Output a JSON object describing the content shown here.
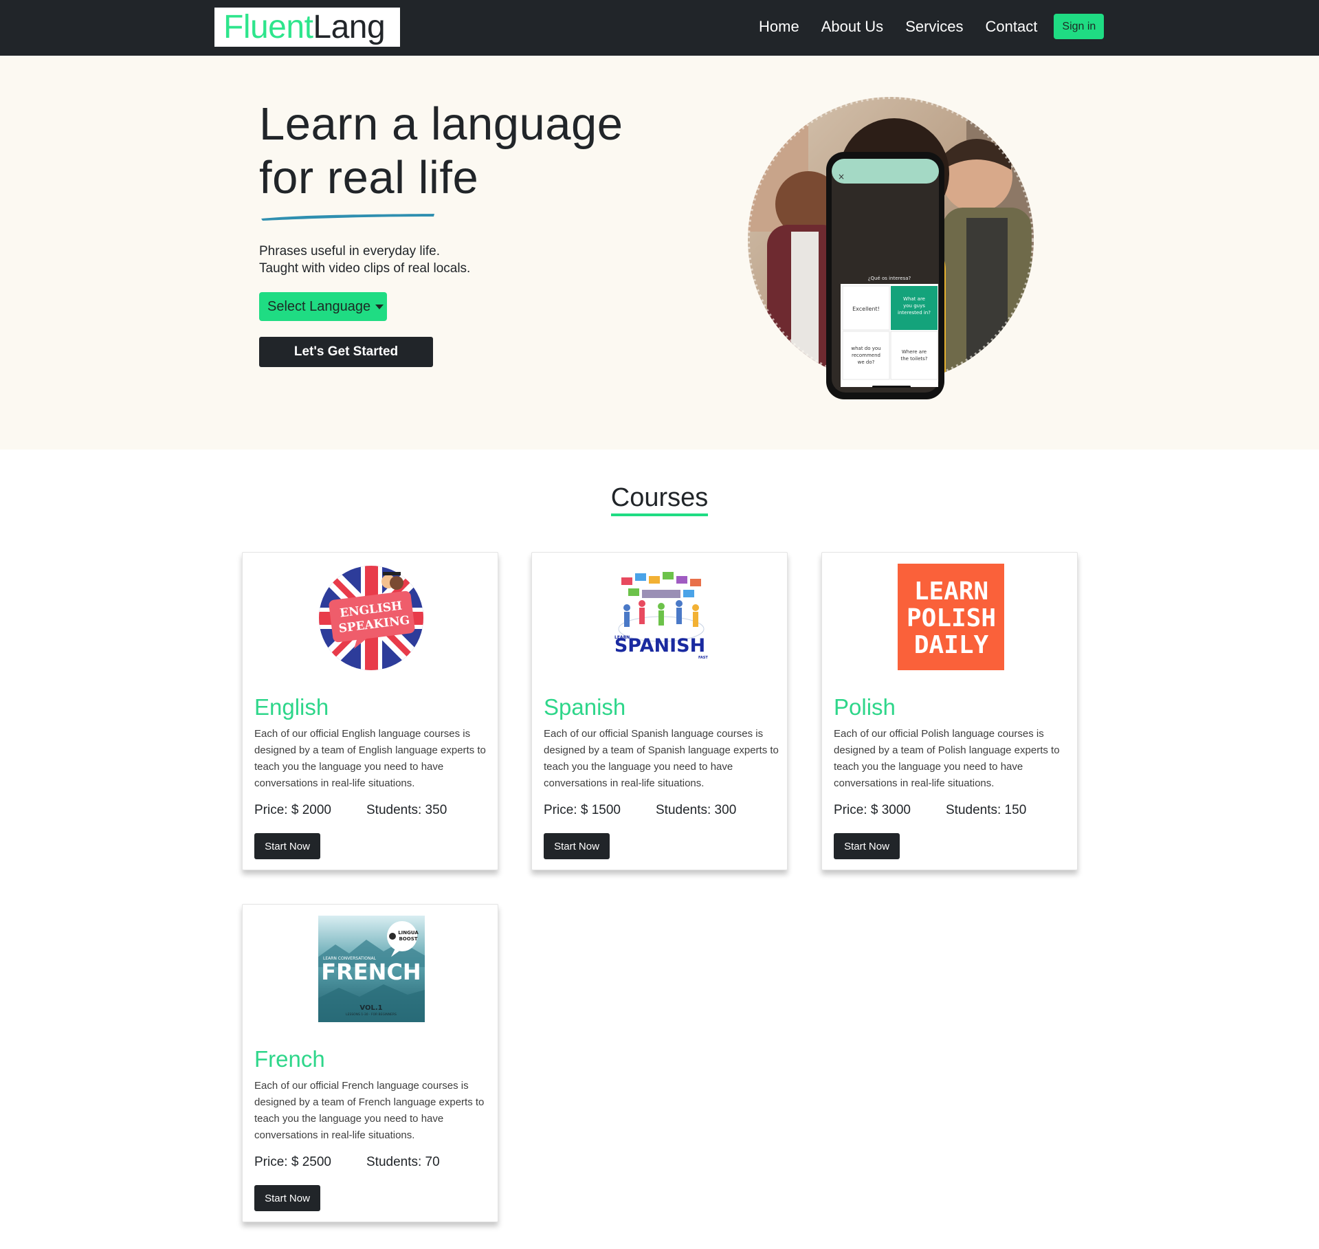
{
  "nav": {
    "logo_part1": "Fluent",
    "logo_part2": "Lang",
    "links": [
      "Home",
      "About Us",
      "Services",
      "Contact"
    ],
    "signin": "Sign in",
    "colors": {
      "bg": "#212529",
      "accent": "#1fdc83"
    }
  },
  "hero": {
    "title_line1": "Learn a language",
    "title_line2": "for real life",
    "sub_line1": "Phrases useful in everyday life.",
    "sub_line2": "Taught with video clips of real locals.",
    "select_language": "Select Language",
    "cta": "Let's Get Started",
    "phone": {
      "question": "¿Qué os interesa?",
      "options": [
        "Excellent!",
        "What are you guys interested in?",
        "what do you recommend we do?",
        "Where are the toilets?"
      ]
    }
  },
  "courses": {
    "title": "Courses",
    "items": [
      {
        "name": "English",
        "desc": "Each of our official English language courses is designed by a team of English language experts to teach you the language you need to have conversations in real-life situations.",
        "price": "Price: $ 2000",
        "students": "Students: 350",
        "button": "Start Now",
        "thumb_text": [
          "ENGLISH",
          "SPEAKING"
        ]
      },
      {
        "name": "Spanish",
        "desc": "Each of our official Spanish language courses is designed by a team of Spanish language experts to teach you the language you need to have conversations in real-life situations.",
        "price": "Price: $ 1500",
        "students": "Students: 300",
        "button": "Start Now",
        "thumb_text": [
          "LEARN",
          "SPANISH",
          "FAST"
        ]
      },
      {
        "name": "Polish",
        "desc": "Each of our official Polish language courses is designed by a team of Polish language experts to teach you the language you need to have conversations in real-life situations.",
        "price": "Price: $ 3000",
        "students": "Students: 150",
        "button": "Start Now",
        "thumb_text": [
          "LEARN",
          "POLISH",
          "DAILY"
        ]
      },
      {
        "name": "French",
        "desc": "Each of our official French language courses is designed by a team of French language experts to teach you the language you need to have conversations in real-life situations.",
        "price": "Price: $ 2500",
        "students": "Students: 70",
        "button": "Start Now",
        "thumb_text": [
          "LINGUA",
          "BOOST",
          "LEARN CONVERSATIONAL",
          "FRENCH",
          "VOL.1",
          "LESSONS 1-30 · FOR BEGINNERS"
        ]
      }
    ]
  }
}
